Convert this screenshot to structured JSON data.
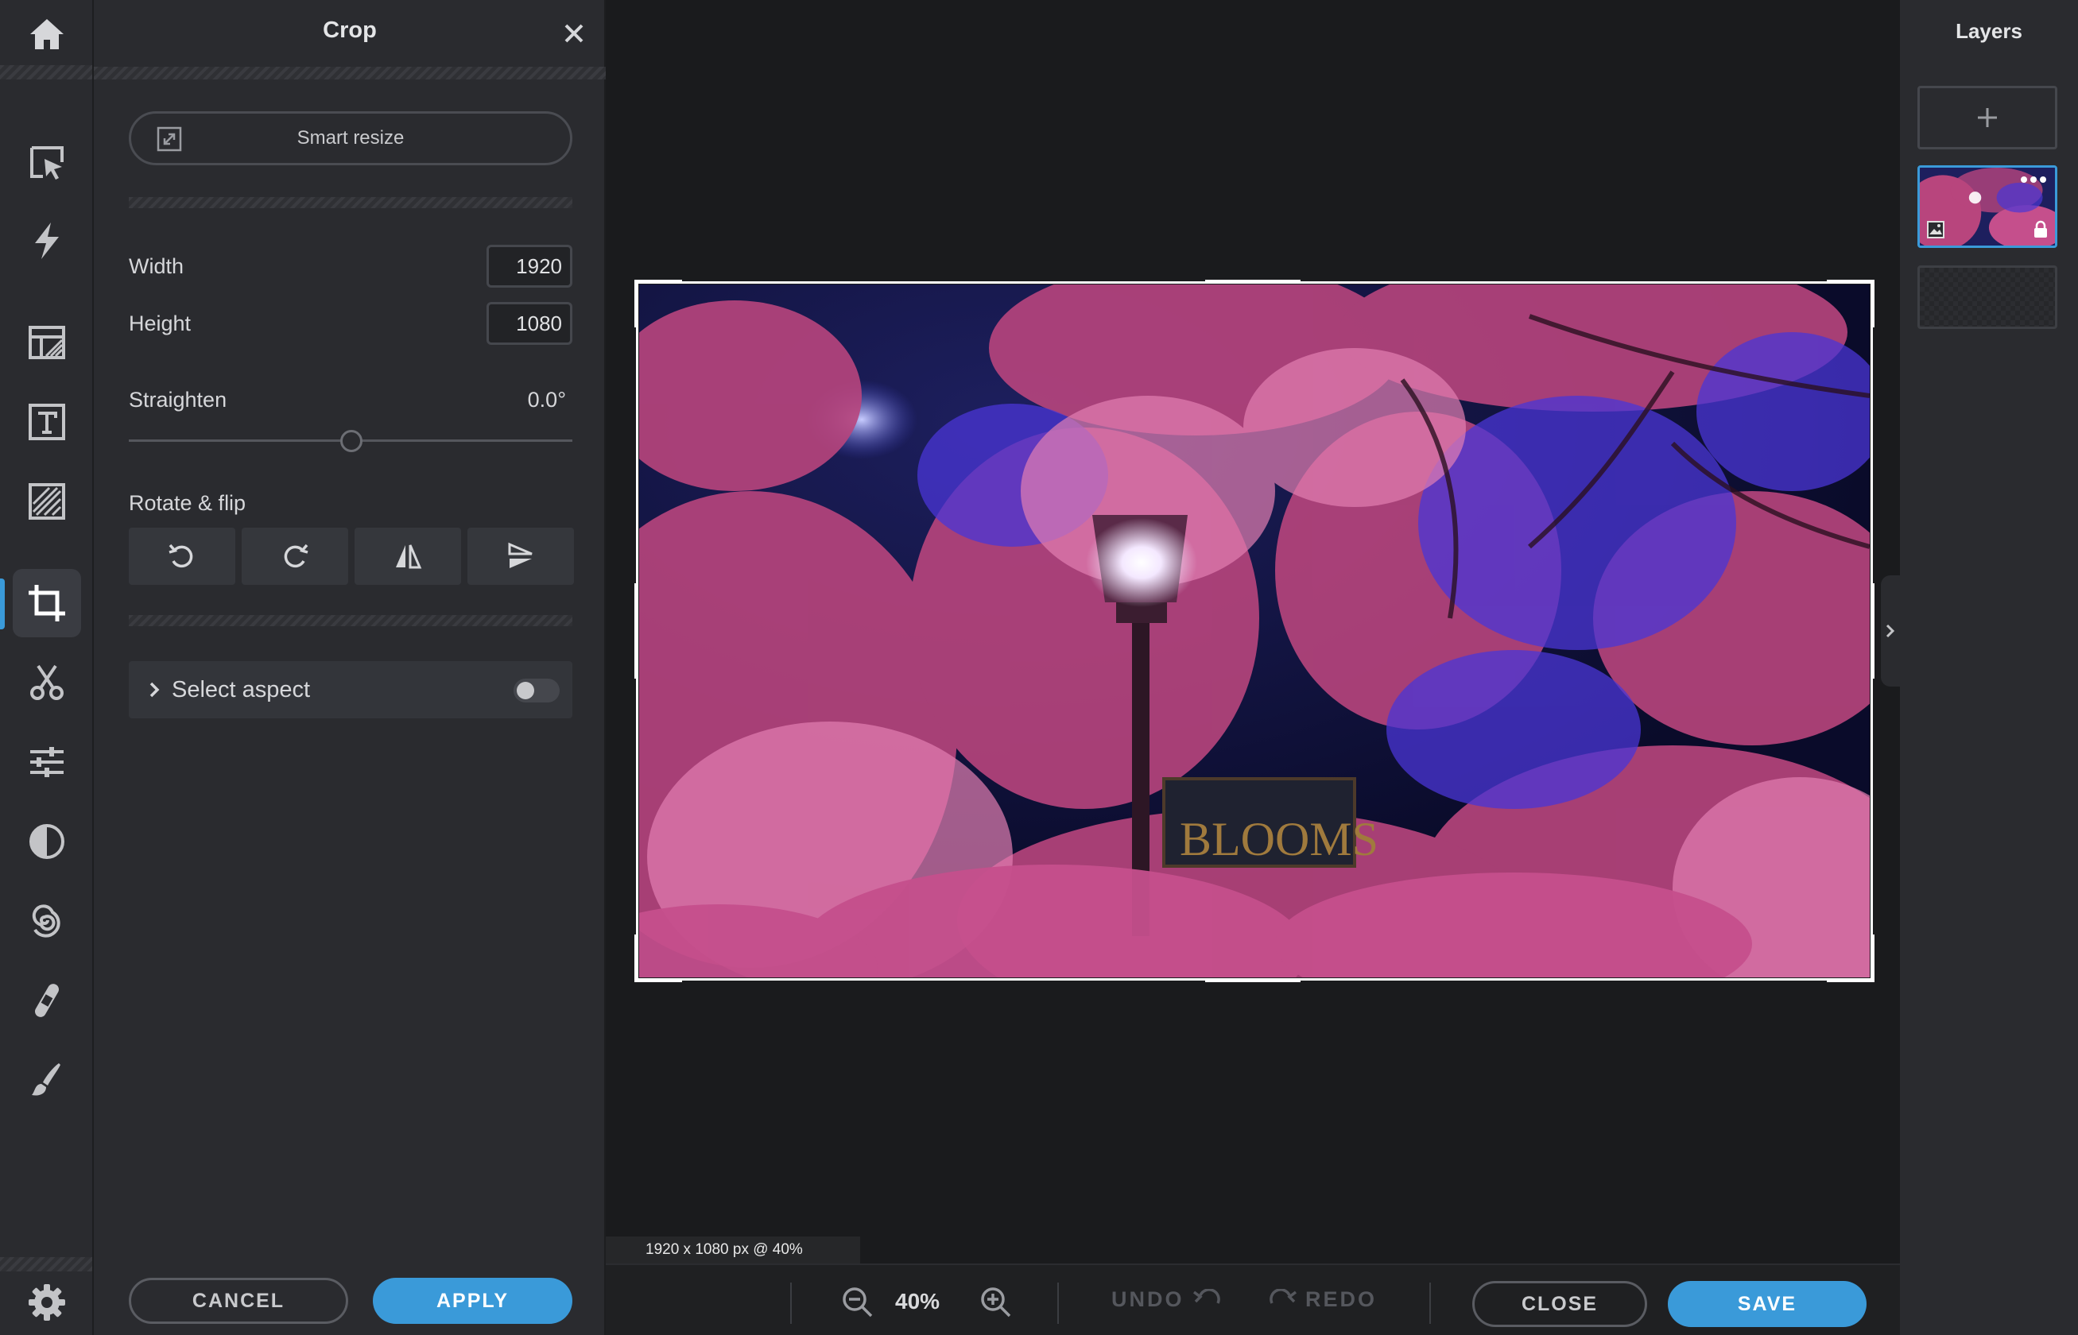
{
  "crop_panel": {
    "title": "Crop",
    "smart_resize_label": "Smart resize",
    "width_label": "Width",
    "width_value": "1920",
    "height_label": "Height",
    "height_value": "1080",
    "straighten_label": "Straighten",
    "straighten_value": "0.0°",
    "straighten_level": 0.5,
    "rotate_flip_label": "Rotate & flip",
    "select_aspect_label": "Select aspect",
    "select_aspect_enabled": false,
    "cancel_label": "CANCEL",
    "apply_label": "APPLY"
  },
  "canvas": {
    "size_info": "1920 x 1080 px @ 40%"
  },
  "bottom_bar": {
    "zoom_value": "40%",
    "undo_label": "UNDO",
    "redo_label": "REDO",
    "close_label": "CLOSE",
    "save_label": "SAVE"
  },
  "layers": {
    "title": "Layers"
  },
  "tools": [
    "home-icon",
    "arrange-icon",
    "quick-edit-icon",
    "templates-icon",
    "text-icon",
    "texture-icon",
    "crop-icon",
    "cutout-icon",
    "adjust-icon",
    "effects-icon",
    "distort-icon",
    "retouch-icon",
    "draw-icon",
    "settings-icon"
  ],
  "colors": {
    "accent": "#3a9ad9",
    "panel": "#2a2b2f",
    "canvas": "#1a1b1d"
  }
}
